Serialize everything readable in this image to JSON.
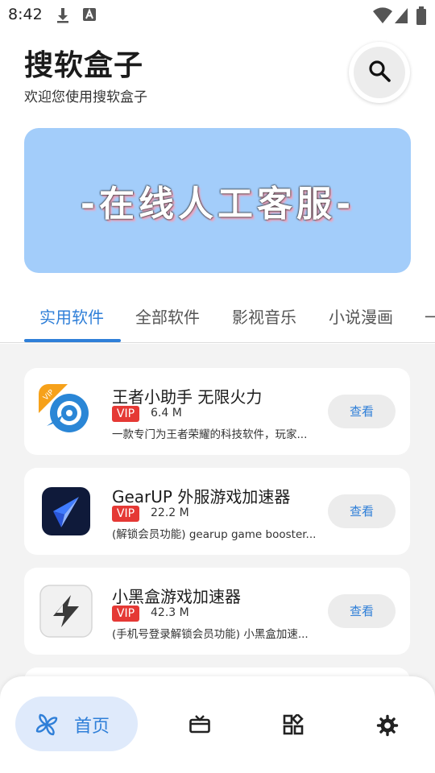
{
  "status_bar": {
    "time": "8:42",
    "left_icons": [
      "download-icon",
      "text-a-icon"
    ],
    "right_icons": [
      "wifi-icon",
      "signal-icon",
      "battery-icon"
    ]
  },
  "header": {
    "title": "搜软盒子",
    "subtitle": "欢迎您使用搜软盒子",
    "search_icon": "search-icon"
  },
  "banner": {
    "text": "-在线人工客服-",
    "background": "#a3cdfa"
  },
  "tabs": [
    {
      "label": "实用软件",
      "active": true
    },
    {
      "label": "全部软件",
      "active": false
    },
    {
      "label": "影视音乐",
      "active": false
    },
    {
      "label": "小说漫画",
      "active": false
    },
    {
      "label": "一",
      "active": false
    }
  ],
  "apps": [
    {
      "name": "王者小助手 无限火力",
      "badge": "VIP",
      "size": "6.4 M",
      "description": "一款专门为王者荣耀的科技软件，玩家...",
      "button": "查看",
      "icon": "king-helper-icon"
    },
    {
      "name": "GearUP 外服游戏加速器",
      "badge": "VIP",
      "size": "22.2 M",
      "description": "(解锁会员功能) gearup game booster...",
      "button": "查看",
      "icon": "gearup-icon"
    },
    {
      "name": "小黑盒游戏加速器",
      "badge": "VIP",
      "size": "42.3 M",
      "description": "(手机号登录解锁会员功能) 小黑盒加速...",
      "button": "查看",
      "icon": "xiaoheihe-icon"
    }
  ],
  "bottom_nav": {
    "home_label": "首页",
    "items": [
      "pinwheel-icon",
      "gift-box-icon",
      "apps-grid-icon",
      "gear-icon"
    ]
  },
  "colors": {
    "accent": "#2f7fd8",
    "vip": "#e53935",
    "content_bg": "#f3f3f3",
    "home_pill": "#dfeafb"
  }
}
